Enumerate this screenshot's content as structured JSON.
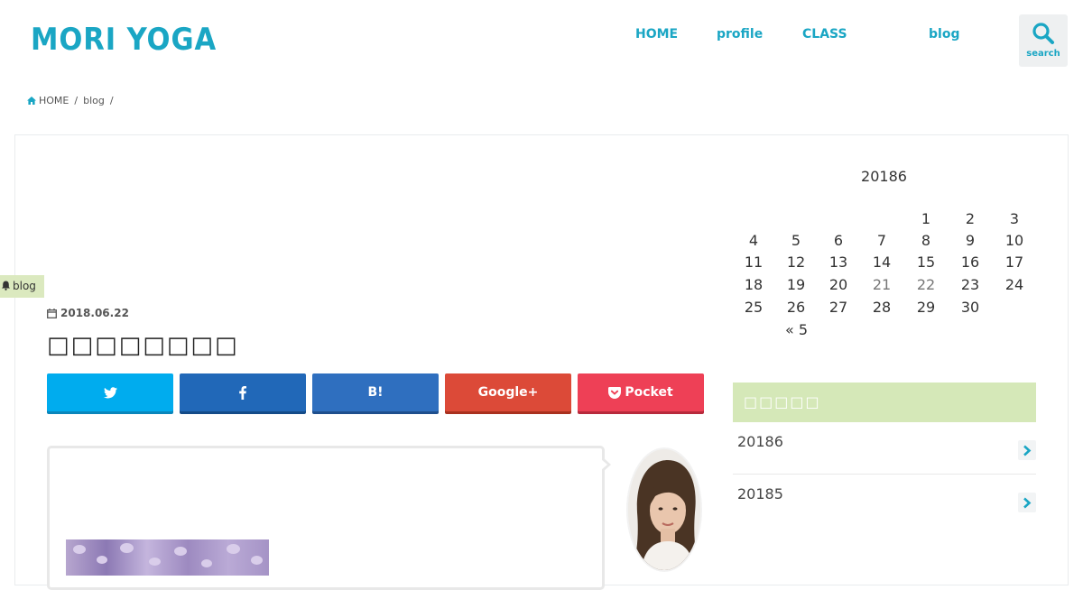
{
  "site": {
    "logo": "MORI YOGA",
    "colors": {
      "accent": "#1aa6c4",
      "green": "#d5e8b8"
    }
  },
  "nav": {
    "items": [
      {
        "label": "HOME"
      },
      {
        "label": "profile"
      },
      {
        "label": "CLASS"
      },
      {
        "label": "blog"
      }
    ],
    "search_label": "search"
  },
  "breadcrumb": {
    "home": "HOME",
    "blog": "blog",
    "sep": "/"
  },
  "post": {
    "category": "blog",
    "date": "2018.06.22",
    "title": "□□□□□□□□",
    "share": {
      "twitter_icon": "twitter-icon",
      "facebook_icon": "facebook-icon",
      "hatena": "B!",
      "google": "Google+",
      "pocket": "Pocket"
    }
  },
  "calendar": {
    "caption": "20186",
    "weeks": [
      [
        "",
        "",
        "",
        "",
        "1",
        "2",
        "3"
      ],
      [
        "4",
        "5",
        "6",
        "7",
        "8",
        "9",
        "10"
      ],
      [
        "11",
        "12",
        "13",
        "14",
        "15",
        "16",
        "17"
      ],
      [
        "18",
        "19",
        "20",
        "21",
        "22",
        "23",
        "24"
      ],
      [
        "25",
        "26",
        "27",
        "28",
        "29",
        "30",
        ""
      ]
    ],
    "dim_days": [
      "21",
      "22"
    ],
    "prev": "« 5"
  },
  "archive": {
    "title": "□□□□□",
    "items": [
      {
        "label": "20186"
      },
      {
        "label": "20185"
      }
    ]
  }
}
